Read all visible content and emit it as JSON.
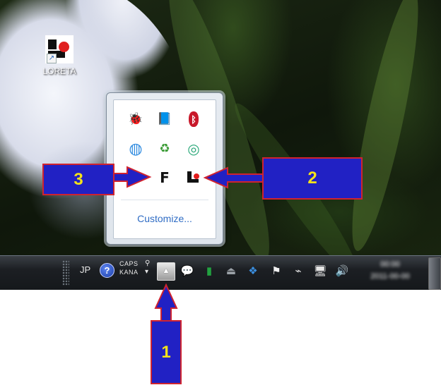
{
  "desktop": {
    "shortcut": {
      "label": "LORETA",
      "icon": "loreta-app-icon"
    }
  },
  "overflow_panel": {
    "icons": [
      {
        "name": "bug-icon",
        "glyph": "🐞"
      },
      {
        "name": "book-icon",
        "glyph": "📘"
      },
      {
        "name": "bluetooth-icon",
        "glyph": "ᛒ"
      },
      {
        "name": "globe-icon",
        "glyph": "◍"
      },
      {
        "name": "sync-icon",
        "glyph": "♻"
      },
      {
        "name": "green-ring-icon",
        "glyph": "◎"
      },
      {
        "name": "red-disc-icon",
        "glyph": "●"
      },
      {
        "name": "f-app-icon",
        "glyph": "F"
      },
      {
        "name": "loreta-tray-icon",
        "glyph": "L"
      }
    ],
    "customize_label": "Customize..."
  },
  "taskbar": {
    "language": "JP",
    "ime_line1": "CAPS",
    "ime_line2": "KANA",
    "ime_glyph": "⚲",
    "ime_arrow": "▾",
    "overflow_button_glyph": "▲",
    "icons": [
      {
        "name": "chat-bubble-icon",
        "glyph": "💬"
      },
      {
        "name": "green-book-icon",
        "glyph": "▮"
      },
      {
        "name": "usb-safely-remove-icon",
        "glyph": "⏏"
      },
      {
        "name": "dropbox-icon",
        "glyph": "❖"
      },
      {
        "name": "action-center-flag-icon",
        "glyph": "⚑"
      },
      {
        "name": "power-plug-icon",
        "glyph": "⌁"
      },
      {
        "name": "network-icon",
        "glyph": "🖥"
      },
      {
        "name": "volume-icon",
        "glyph": "🔊"
      }
    ],
    "clock_time": "00:00",
    "clock_date": "2011-00-00"
  },
  "annotations": {
    "callout_1": "1",
    "callout_2": "2",
    "callout_3": "3",
    "color_fill": "#2121c4",
    "color_border": "#d0232f",
    "color_text": "#f4e21a"
  }
}
